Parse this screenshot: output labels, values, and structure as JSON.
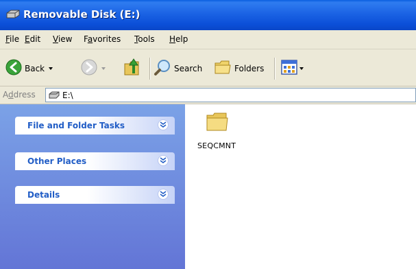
{
  "window": {
    "title": "Removable Disk (E:)"
  },
  "menu": {
    "items": [
      {
        "ul": "F",
        "rest": "ile"
      },
      {
        "ul": "E",
        "rest": "dit"
      },
      {
        "ul": "V",
        "rest": "iew"
      },
      {
        "pre": "F",
        "ul": "a",
        "rest": "vorites"
      },
      {
        "ul": "T",
        "rest": "ools"
      },
      {
        "ul": "H",
        "rest": "elp"
      }
    ]
  },
  "toolbar": {
    "back_label": "Back",
    "search_label": "Search",
    "folders_label": "Folders"
  },
  "address": {
    "label_pre": "A",
    "label_ul": "d",
    "label_rest": "dress",
    "value": "E:\\"
  },
  "taskpane": {
    "sections": [
      {
        "label": "File and Folder Tasks"
      },
      {
        "label": "Other Places"
      },
      {
        "label": "Details"
      }
    ]
  },
  "content": {
    "items": [
      {
        "name": "SEQCMNT",
        "type": "folder"
      }
    ]
  },
  "colors": {
    "titlebar": "#0a5fe0",
    "chrome": "#ece9d8",
    "taskpane_top": "#7ba2e7",
    "taskpane_bottom": "#6375d6",
    "task_label": "#215dc6"
  }
}
